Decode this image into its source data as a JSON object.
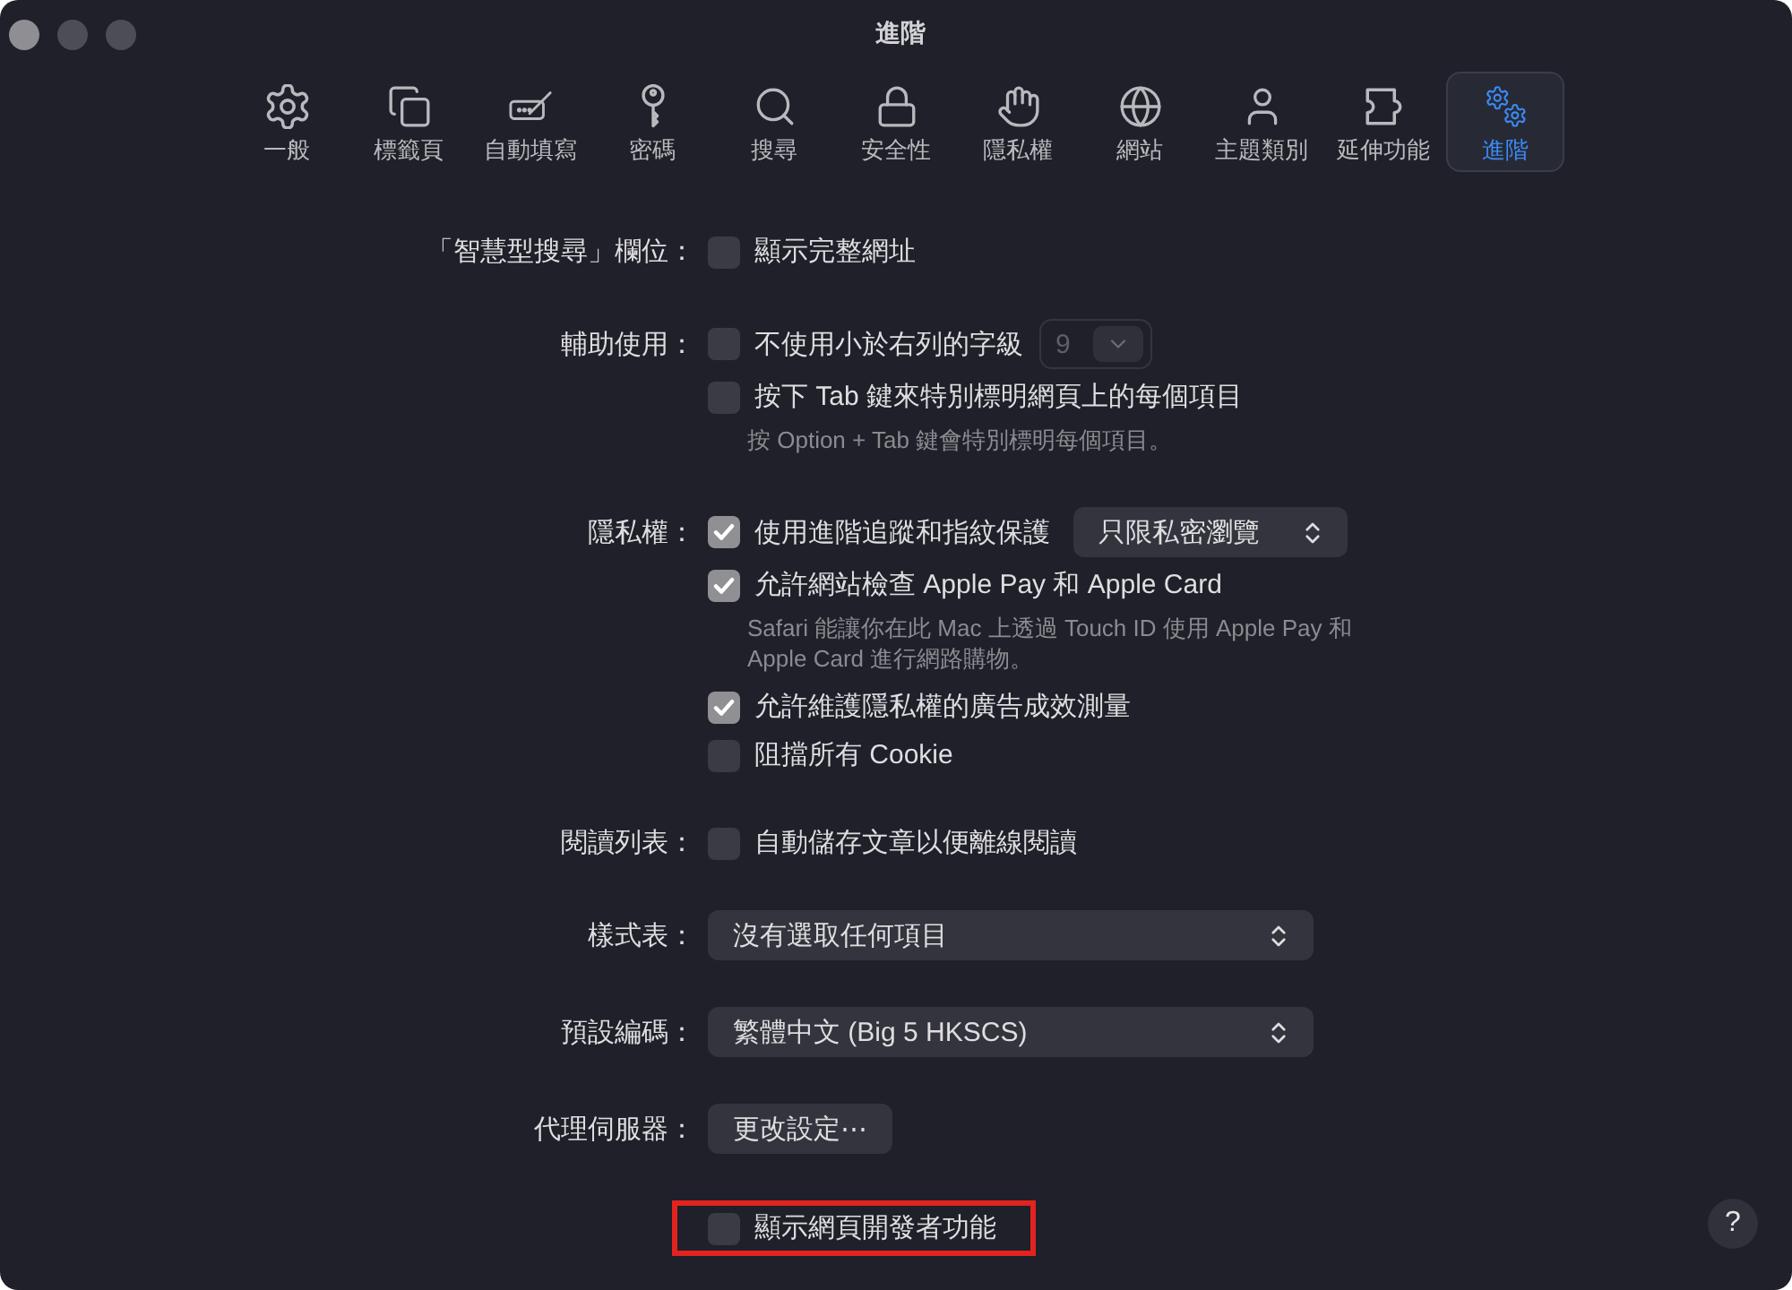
{
  "window": {
    "title": "進階"
  },
  "toolbar": [
    {
      "label": "一般",
      "selected": false
    },
    {
      "label": "標籤頁",
      "selected": false
    },
    {
      "label": "自動填寫",
      "selected": false
    },
    {
      "label": "密碼",
      "selected": false
    },
    {
      "label": "搜尋",
      "selected": false
    },
    {
      "label": "安全性",
      "selected": false
    },
    {
      "label": "隱私權",
      "selected": false
    },
    {
      "label": "網站",
      "selected": false
    },
    {
      "label": "主題類別",
      "selected": false
    },
    {
      "label": "延伸功能",
      "selected": false
    },
    {
      "label": "進階",
      "selected": true
    }
  ],
  "sections": [
    {
      "label": "「智慧型搜尋」欄位：",
      "rows": [
        {
          "kind": "checkbox",
          "text": "顯示完整網址",
          "checked": false
        }
      ]
    },
    {
      "label": "輔助使用：",
      "rows": [
        {
          "kind": "checkbox",
          "text": "不使用小於右列的字級",
          "checked": false,
          "stepper": {
            "value": "9",
            "disabled": true
          }
        },
        {
          "kind": "checkbox",
          "text": "按下 Tab 鍵來特別標明網頁上的每個項目",
          "checked": false
        },
        {
          "kind": "hint",
          "text": "按 Option + Tab 鍵會特別標明每個項目。"
        }
      ]
    },
    {
      "label": "隱私權：",
      "rows": [
        {
          "kind": "checkbox",
          "text": "使用進階追蹤和指紋保護",
          "checked": true,
          "popup": {
            "value": "只限私密瀏覽"
          }
        },
        {
          "kind": "checkbox",
          "text": "允許網站檢查 Apple Pay 和 Apple Card",
          "checked": true
        },
        {
          "kind": "hint",
          "text": "Safari 能讓你在此 Mac 上透過 Touch ID 使用 Apple Pay 和 Apple Card 進行網路購物。"
        },
        {
          "kind": "checkbox",
          "text": "允許維護隱私權的廣告成效測量",
          "checked": true
        },
        {
          "kind": "checkbox",
          "text": "阻擋所有 Cookie",
          "checked": false
        }
      ]
    },
    {
      "label": "閱讀列表：",
      "rows": [
        {
          "kind": "checkbox",
          "text": "自動儲存文章以便離線閱讀",
          "checked": false
        }
      ]
    },
    {
      "label": "樣式表：",
      "rows": [
        {
          "kind": "popup",
          "value": "沒有選取任何項目"
        }
      ]
    },
    {
      "label": "預設編碼：",
      "rows": [
        {
          "kind": "popup",
          "value": "繁體中文 (Big 5 HKSCS)"
        }
      ]
    },
    {
      "label": "代理伺服器：",
      "rows": [
        {
          "kind": "button",
          "text": "更改設定⋯"
        }
      ]
    },
    {
      "rows": [
        {
          "kind": "checkbox",
          "text": "顯示網頁開發者功能",
          "checked": false,
          "highlighted": true
        }
      ]
    }
  ],
  "help_button": {
    "label": "?"
  }
}
